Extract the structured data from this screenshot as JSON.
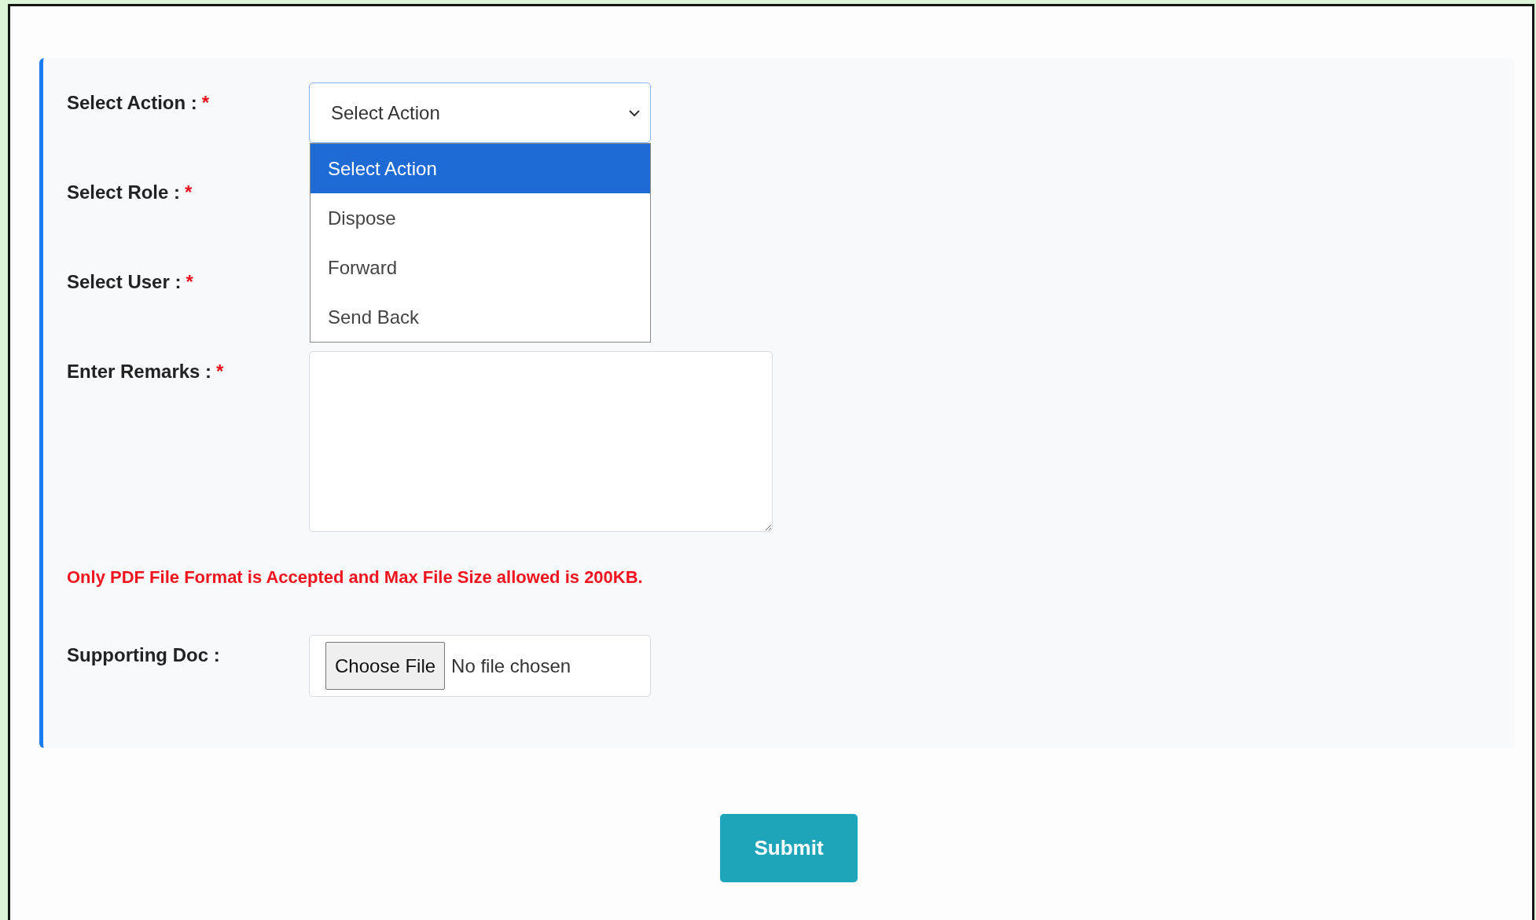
{
  "form": {
    "fields": [
      {
        "kind": "select",
        "label": "Select Action :",
        "required_mark": "*",
        "value": "Select Action",
        "expanded": true,
        "options": [
          {
            "label": "Select Action",
            "selected": true
          },
          {
            "label": "Dispose",
            "selected": false
          },
          {
            "label": "Forward",
            "selected": false
          },
          {
            "label": "Send Back",
            "selected": false
          }
        ]
      },
      {
        "kind": "covered",
        "label": "Select Role :",
        "required_mark": "*"
      },
      {
        "kind": "covered",
        "label": "Select User :",
        "required_mark": "*"
      },
      {
        "kind": "textarea",
        "label": "Enter Remarks :",
        "required_mark": "*"
      }
    ],
    "note": "Only PDF File Format is Accepted and Max File Size allowed is 200KB.",
    "upload": {
      "label": "Supporting Doc :",
      "button": "Choose File",
      "status": "No file chosen"
    }
  },
  "submit": "Submit"
}
